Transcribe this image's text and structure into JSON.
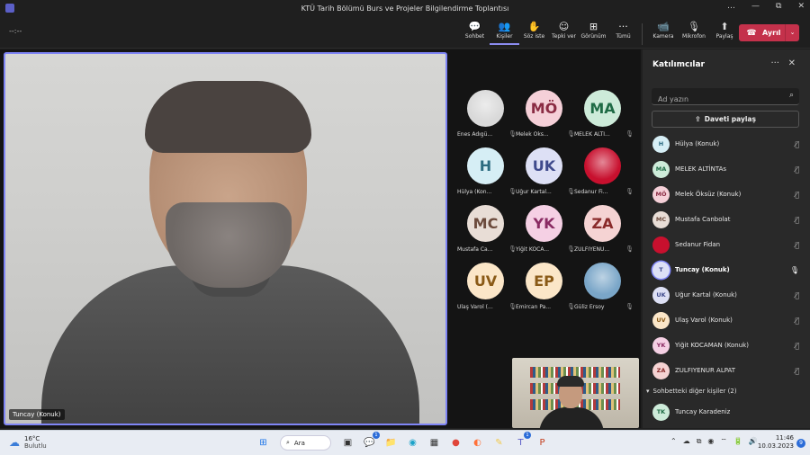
{
  "window": {
    "title": "KTÜ Tarih Bölümü Burs ve Projeler Bilgilendirme Toplantısı",
    "controls": [
      "…",
      "—",
      "⧉",
      "✕"
    ]
  },
  "toolbar": {
    "timer": "--:--",
    "items": [
      {
        "label": "Sohbet",
        "icon": "💬"
      },
      {
        "label": "Kişiler",
        "icon": "👥",
        "active": true
      },
      {
        "label": "Söz iste",
        "icon": "✋"
      },
      {
        "label": "Tepki ver",
        "icon": "☺"
      },
      {
        "label": "Görünüm",
        "icon": "⊞"
      },
      {
        "label": "Tümü",
        "icon": "···"
      }
    ],
    "devices": [
      {
        "label": "Kamera",
        "icon": "📹"
      },
      {
        "label": "Mikrofon",
        "icon": "🎙"
      },
      {
        "label": "Paylaş",
        "icon": "⬆"
      }
    ],
    "leave": {
      "label": "Ayrıl",
      "icon": "☎",
      "chevron": "⌄"
    }
  },
  "main_video": {
    "name": "Tuncay (Konuk)"
  },
  "grid_tiles": [
    {
      "initials": "",
      "name": "Enes Adıgü...",
      "bg": "#d9d9d9",
      "fg": "#333",
      "photo": true
    },
    {
      "initials": "MÖ",
      "name": "Melek Öks...",
      "bg": "#f5d0d8",
      "fg": "#8a2b43"
    },
    {
      "initials": "MA",
      "name": "MELEK ALTI...",
      "bg": "#cdebd9",
      "fg": "#1f6b45"
    },
    {
      "initials": "H",
      "name": "Hülya (Kon...",
      "bg": "#d6eef5",
      "fg": "#2b6b80"
    },
    {
      "initials": "UK",
      "name": "Uğur Kartal...",
      "bg": "#dde0f5",
      "fg": "#3f4a8c"
    },
    {
      "initials": "",
      "name": "Sedanur Fi...",
      "bg": "#c8102e",
      "fg": "#fff",
      "photo": true
    },
    {
      "initials": "MC",
      "name": "Mustafa Ca...",
      "bg": "#e8ddd6",
      "fg": "#6b4a3c"
    },
    {
      "initials": "YK",
      "name": "Yiğit KOCA...",
      "bg": "#f5d0e4",
      "fg": "#8a2b63"
    },
    {
      "initials": "ZA",
      "name": "ZULFIYENU...",
      "bg": "#f5d3d3",
      "fg": "#8a2b2b"
    },
    {
      "initials": "UV",
      "name": "Ulaş Varol (...",
      "bg": "#fbe6c8",
      "fg": "#8a5a17"
    },
    {
      "initials": "EP",
      "name": "Emircan Pa...",
      "bg": "#fbe6c8",
      "fg": "#8a5a17"
    },
    {
      "initials": "",
      "name": "Güliz Ersoy",
      "bg": "#7aa6c8",
      "fg": "#fff",
      "photo": true
    }
  ],
  "panel": {
    "title": "Katılımcılar",
    "more_icon": "···",
    "close_icon": "✕",
    "search_placeholder": "Ad yazın",
    "search_icon": "⌕",
    "invite_label": "Daveti paylaş",
    "invite_icon": "⇪",
    "participants": [
      {
        "initials": "H",
        "name": "Hülya (Konuk)",
        "bg": "#d6eef5",
        "fg": "#2b6b80",
        "mic": "🎙̸"
      },
      {
        "initials": "MA",
        "name": "MELEK ALTİNTAs",
        "bg": "#cdebd9",
        "fg": "#1f6b45",
        "mic": "🎙̸"
      },
      {
        "initials": "MÖ",
        "name": "Melek Öksüz (Konuk)",
        "bg": "#f5d0d8",
        "fg": "#8a2b43",
        "mic": "🎙̸"
      },
      {
        "initials": "MC",
        "name": "Mustafa Canbolat",
        "bg": "#e8ddd6",
        "fg": "#6b4a3c",
        "mic": "🎙̸"
      },
      {
        "initials": "",
        "name": "Sedanur Fidan",
        "bg": "#c8102e",
        "fg": "#fff",
        "mic": "🎙̸"
      },
      {
        "initials": "T",
        "name": "Tuncay (Konuk)",
        "bg": "#dde0f5",
        "fg": "#3f4a8c",
        "mic": "🎙",
        "speaking": true
      },
      {
        "initials": "UK",
        "name": "Uğur Kartal (Konuk)",
        "bg": "#dde0f5",
        "fg": "#3f4a8c",
        "mic": "🎙̸"
      },
      {
        "initials": "UV",
        "name": "Ulaş Varol (Konuk)",
        "bg": "#fbe6c8",
        "fg": "#8a5a17",
        "mic": "🎙̸"
      },
      {
        "initials": "YK",
        "name": "Yiğit KOCAMAN (Konuk)",
        "bg": "#f5d0e4",
        "fg": "#8a2b63",
        "mic": "🎙̸"
      },
      {
        "initials": "ZA",
        "name": "ZULFIYENUR ALPAT",
        "bg": "#f5d3d3",
        "fg": "#8a2b2b",
        "mic": "🎙̸"
      }
    ],
    "section": {
      "label": "Sohbetteki diğer kişiler (2)",
      "icon": "▾"
    },
    "others": [
      {
        "initials": "TK",
        "name": "Tuncay Karadeniz",
        "bg": "#cdebd9",
        "fg": "#1f6b45"
      }
    ]
  },
  "taskbar": {
    "weather_temp": "16°C",
    "weather_desc": "Bulutlu",
    "search_label": "Ara",
    "apps": [
      {
        "icon": "⊞",
        "name": "start",
        "color": "#1a73e8"
      },
      {
        "icon": "⌕",
        "name": "search"
      },
      {
        "icon": "▣",
        "name": "task-view",
        "color": "#333"
      },
      {
        "icon": "💬",
        "name": "chat",
        "color": "#5b5fc7",
        "badge": "1"
      },
      {
        "icon": "📁",
        "name": "file-explorer",
        "color": "#e8b73a"
      },
      {
        "icon": "◉",
        "name": "edge",
        "color": "#1ca3c9"
      },
      {
        "icon": "▦",
        "name": "store",
        "color": "#333"
      },
      {
        "icon": "●",
        "name": "chrome",
        "color": "#e0463a"
      },
      {
        "icon": "◐",
        "name": "firefox",
        "color": "#ff7139"
      },
      {
        "icon": "✎",
        "name": "sticky-notes",
        "color": "#f2c94c"
      },
      {
        "icon": "T",
        "name": "teams",
        "color": "#5b5fc7",
        "badge": "1"
      },
      {
        "icon": "P",
        "name": "powerpoint",
        "color": "#c43e1c"
      }
    ],
    "tray": [
      "⌃",
      "☁",
      "⧉",
      "◉",
      "⌔",
      "🔋",
      "🔊"
    ],
    "time": "11:46",
    "date": "10.03.2023",
    "notif_count": "9"
  }
}
